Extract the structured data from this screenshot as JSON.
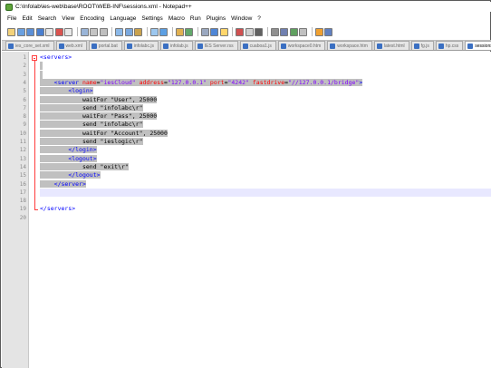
{
  "window": {
    "title": "C:\\Infolab\\ies-web\\base\\ROOT\\WEB-INF\\sessions.xml - Notepad++"
  },
  "menu": [
    "File",
    "Edit",
    "Search",
    "View",
    "Encoding",
    "Language",
    "Settings",
    "Macro",
    "Run",
    "Plugins",
    "Window",
    "?"
  ],
  "tabs": [
    {
      "label": "ies_core_set.xml",
      "active": false
    },
    {
      "label": "web.xml",
      "active": false
    },
    {
      "label": "portal.bat",
      "active": false
    },
    {
      "label": "infolabc.js",
      "active": false
    },
    {
      "label": "infolab.js",
      "active": false
    },
    {
      "label": "IES Server.rss",
      "active": false
    },
    {
      "label": "cuaboa1.js",
      "active": false
    },
    {
      "label": "workspace0.htm",
      "active": false
    },
    {
      "label": "workspace.htm",
      "active": false
    },
    {
      "label": "latest.html",
      "active": false
    },
    {
      "label": "fg.js",
      "active": false
    },
    {
      "label": "hp.css",
      "active": false
    },
    {
      "label": "sessions.xml",
      "active": true
    }
  ],
  "editor": {
    "line_numbers": [
      "1",
      "2",
      "3",
      "4",
      "5",
      "6",
      "7",
      "8",
      "9",
      "10",
      "11",
      "12",
      "13",
      "14",
      "15",
      "16",
      "17",
      "18",
      "19",
      "20"
    ],
    "lines": [
      [
        {
          "t": "tag",
          "v": "<servers>"
        }
      ],
      [],
      [],
      [
        {
          "t": "plain",
          "v": "    "
        },
        {
          "t": "tag",
          "v": "<server "
        },
        {
          "t": "attr",
          "v": "name"
        },
        {
          "t": "plain",
          "v": "="
        },
        {
          "t": "val",
          "v": "\"iesCloud\""
        },
        {
          "t": "plain",
          "v": " "
        },
        {
          "t": "attr",
          "v": "address"
        },
        {
          "t": "plain",
          "v": "="
        },
        {
          "t": "val",
          "v": "\"127.0.0.1\""
        },
        {
          "t": "plain",
          "v": " "
        },
        {
          "t": "attr",
          "v": "port"
        },
        {
          "t": "plain",
          "v": "="
        },
        {
          "t": "val",
          "v": "\"4242\""
        },
        {
          "t": "plain",
          "v": " "
        },
        {
          "t": "attr",
          "v": "fastdrive"
        },
        {
          "t": "plain",
          "v": "="
        },
        {
          "t": "val",
          "v": "\"//127.0.0.1/bridge\""
        },
        {
          "t": "tag",
          "v": ">"
        }
      ],
      [
        {
          "t": "plain",
          "v": "        "
        },
        {
          "t": "tag",
          "v": "<login>"
        }
      ],
      [
        {
          "t": "plain",
          "v": "            waitFor \"User\", 25000"
        }
      ],
      [
        {
          "t": "plain",
          "v": "            send \"infolabc\\r\""
        }
      ],
      [
        {
          "t": "plain",
          "v": "            waitFor \"Pass\", 25000"
        }
      ],
      [
        {
          "t": "plain",
          "v": "            send \"infolabc\\r\""
        }
      ],
      [
        {
          "t": "plain",
          "v": "            waitFor \"Account\", 25000"
        }
      ],
      [
        {
          "t": "plain",
          "v": "            send \"ieslogic\\r\""
        }
      ],
      [
        {
          "t": "plain",
          "v": "        "
        },
        {
          "t": "tag",
          "v": "</login>"
        }
      ],
      [
        {
          "t": "plain",
          "v": "        "
        },
        {
          "t": "tag",
          "v": "<logout>"
        }
      ],
      [
        {
          "t": "plain",
          "v": "            send \"exit\\r\""
        }
      ],
      [
        {
          "t": "plain",
          "v": "        "
        },
        {
          "t": "tag",
          "v": "</logout>"
        }
      ],
      [
        {
          "t": "plain",
          "v": "    "
        },
        {
          "t": "tag",
          "v": "</server>"
        }
      ],
      [],
      [],
      [
        {
          "t": "tag",
          "v": "</servers>"
        }
      ],
      []
    ]
  },
  "colors": {
    "tag": "#0000ff",
    "attr": "#ff0000",
    "value": "#8000ff",
    "selection": "#c0c0c0",
    "current_line": "#e8e8ff",
    "fold_marker": "#ff3b3b"
  }
}
